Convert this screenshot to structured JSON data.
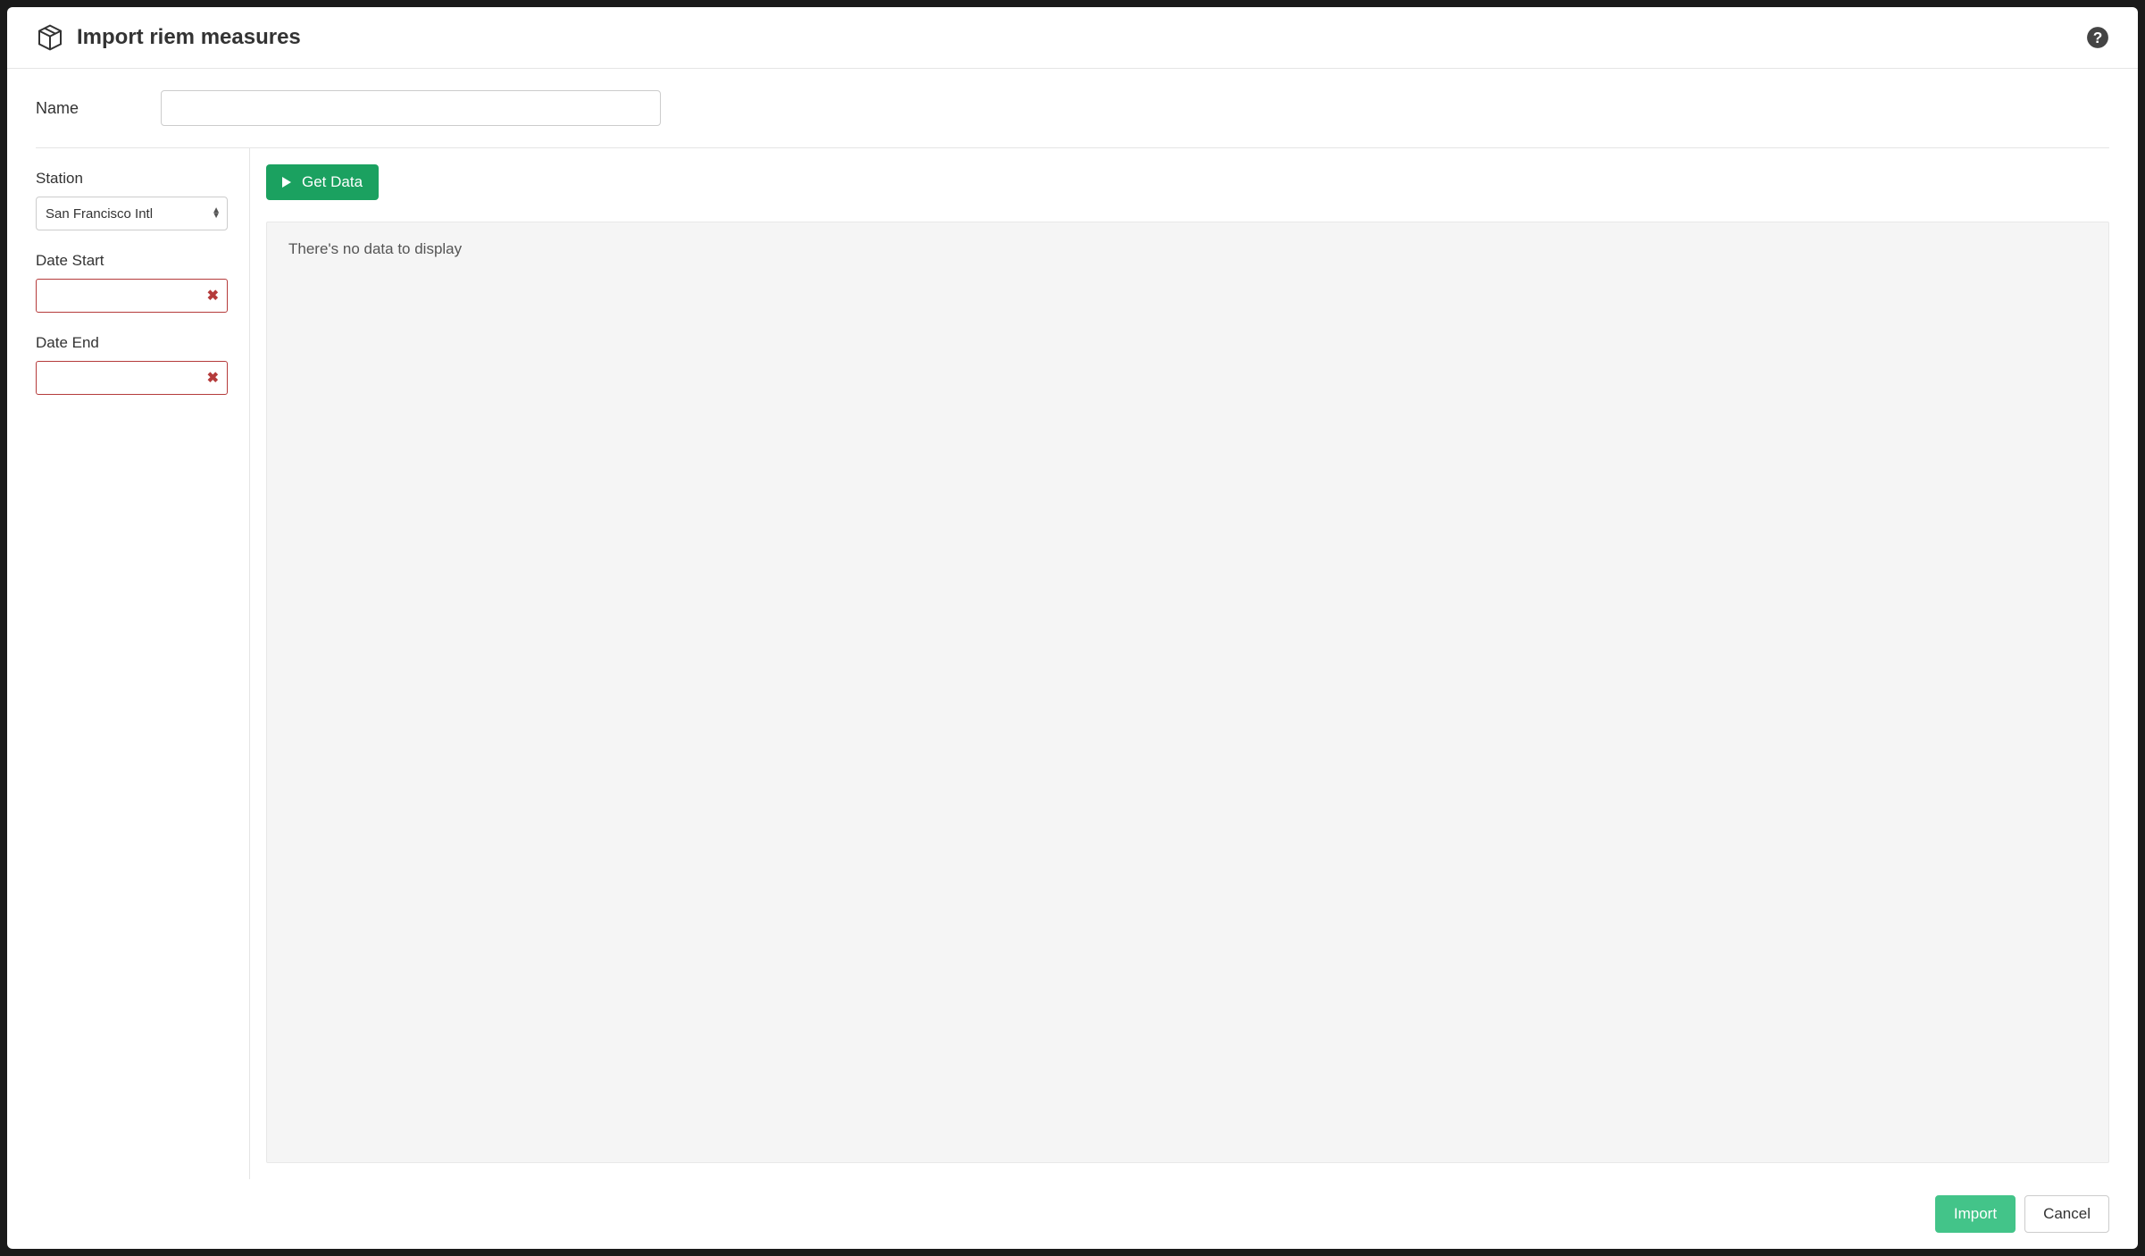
{
  "header": {
    "title": "Import riem measures"
  },
  "form": {
    "name_label": "Name",
    "name_value": "",
    "station_label": "Station",
    "station_selected": "San Francisco Intl",
    "date_start_label": "Date Start",
    "date_start_value": "",
    "date_end_label": "Date End",
    "date_end_value": ""
  },
  "main": {
    "get_data_label": "Get Data",
    "empty_message": "There's no data to display"
  },
  "footer": {
    "import_label": "Import",
    "cancel_label": "Cancel"
  }
}
